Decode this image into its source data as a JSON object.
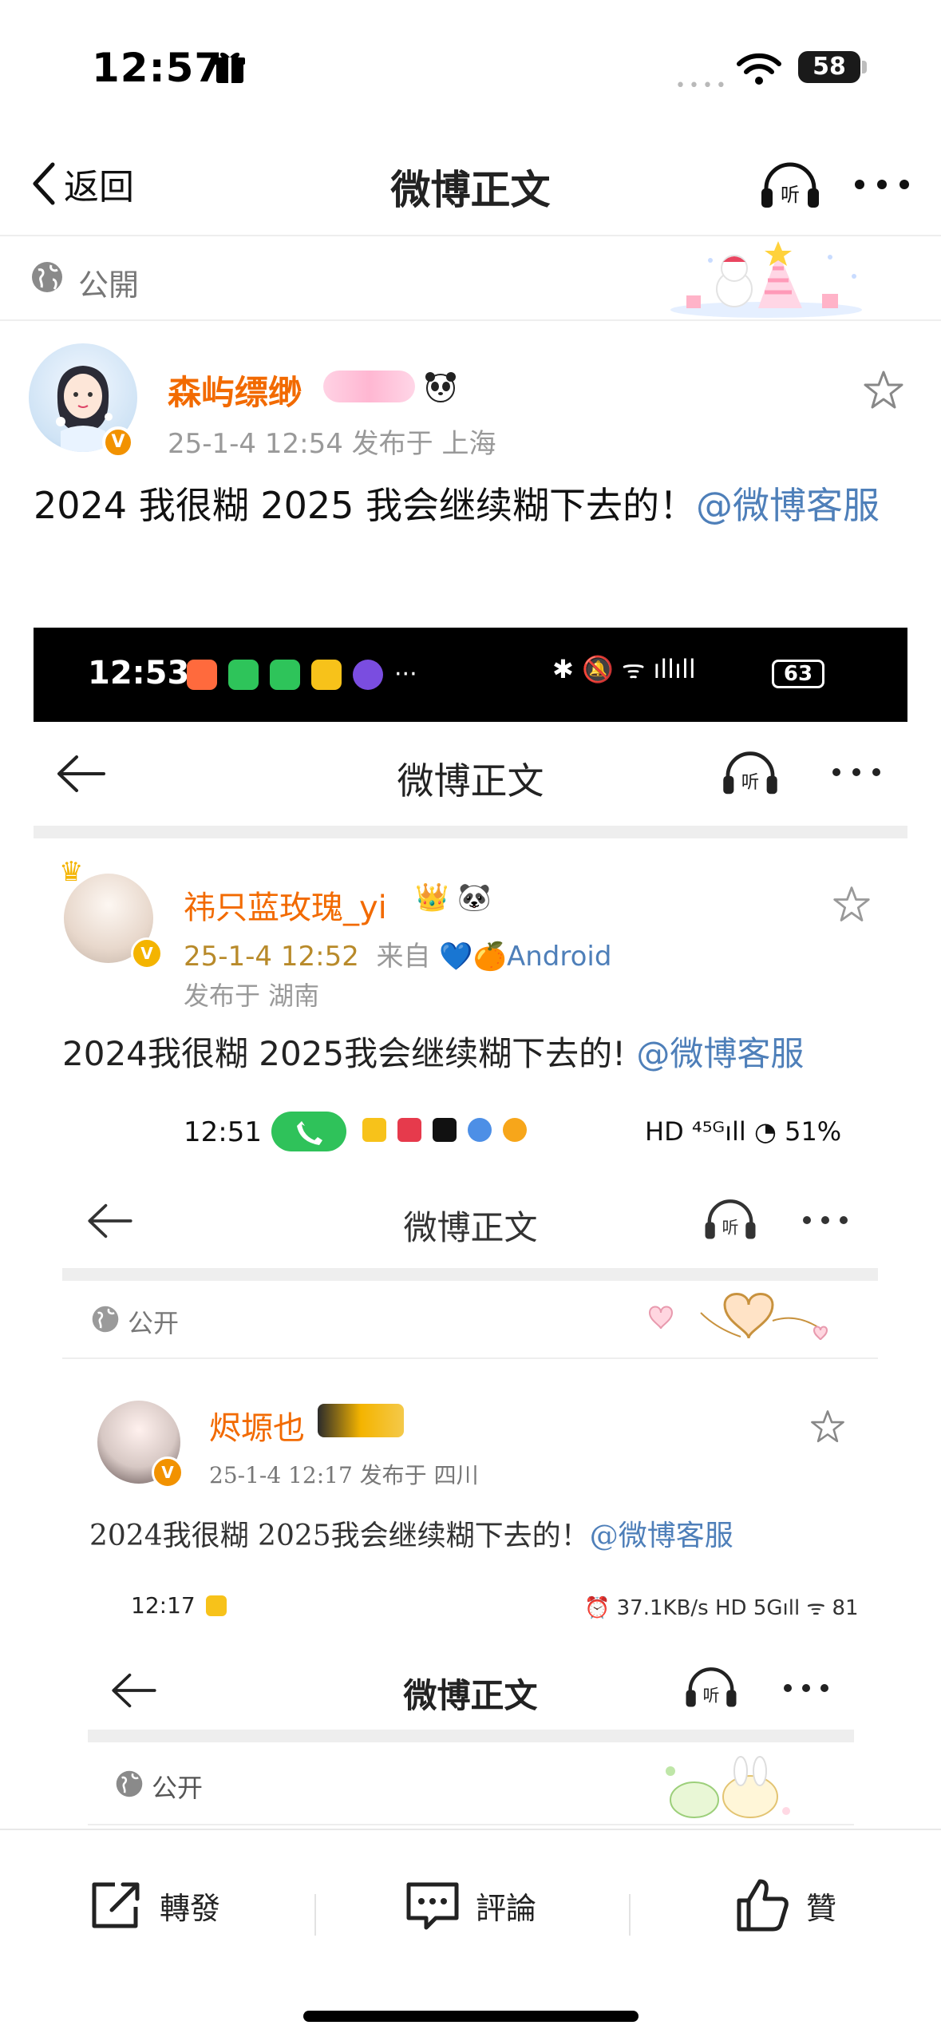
{
  "status_bar": {
    "time": "12:57",
    "signal_dots": "••••",
    "battery": "58"
  },
  "nav": {
    "back_label": "返回",
    "title": "微博正文"
  },
  "visibility": {
    "label": "公開"
  },
  "post": {
    "username": "森屿缥缈",
    "meta": "25-1-4 12:54  发布于 上海",
    "text": "2024 我很糊 2025 我会继续糊下去的！",
    "mention": "@微博客服"
  },
  "embedded_1": {
    "status_time": "12:53",
    "status_right": "✱ 🔕 ᯤ ıllıll",
    "battery": "63",
    "nav_title": "微博正文",
    "username": "祎只蓝玫瑰_yi",
    "name_badges": "👑 🐼",
    "date": "25-1-4 12:52",
    "from_label": "来自",
    "device": "💙🍊Android",
    "location": "发布于 湖南",
    "text": "2024我很糊 2025我会继续糊下去的! ",
    "mention": "@微博客服"
  },
  "embedded_2": {
    "status_time": "12:51",
    "status_right": "HD ⁴⁵ᴳıll ◔ 51%",
    "nav_title": "微博正文",
    "visibility": "公开",
    "username": "烬塬也",
    "meta": "25-1-4 12:17  发布于 四川",
    "text": "2024我很糊 2025我会继续糊下去的！",
    "mention": "@微博客服"
  },
  "embedded_3": {
    "status_time": "12:17",
    "status_right": "⏰ 37.1KB/s HD 5Gıll ᯤ 81",
    "nav_title": "微博正文",
    "visibility": "公开"
  },
  "actions": {
    "repost": "轉發",
    "comment": "評論",
    "like": "贊"
  },
  "colors": {
    "username_orange": "#f26a00",
    "mention_blue": "#4e7fb9"
  },
  "icons": [
    "gift-icon",
    "wifi-icon",
    "back-chevron-icon",
    "listen-headphones-icon",
    "more-icon",
    "globe-icon",
    "star-icon",
    "verified-badge-icon",
    "repost-icon",
    "comment-icon",
    "like-icon"
  ]
}
